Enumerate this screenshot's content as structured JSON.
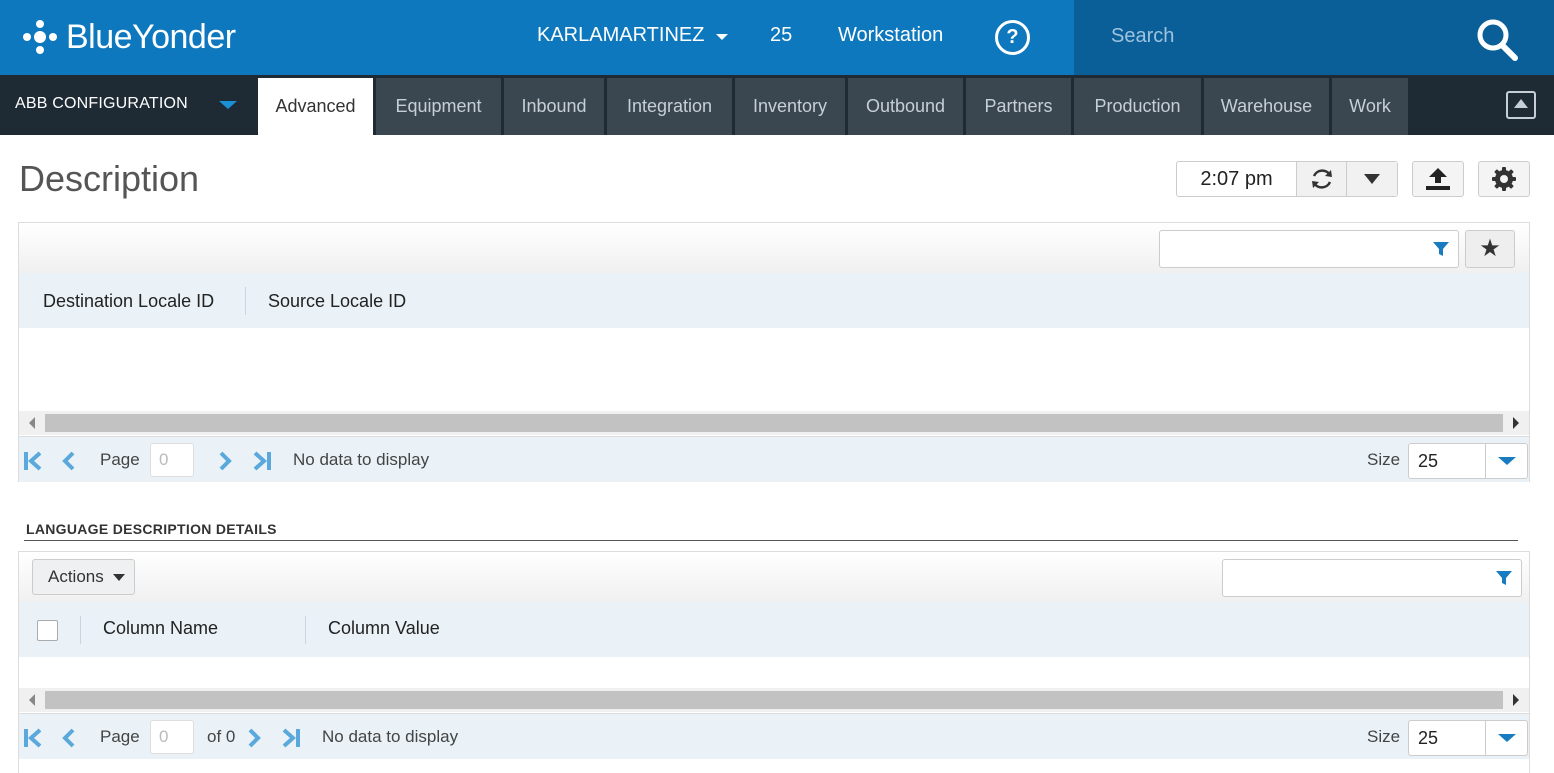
{
  "header": {
    "brand": "BlueYonder",
    "user": "KARLAMARTINEZ",
    "count": "25",
    "workstation": "Workstation",
    "help": "?",
    "search_placeholder": "Search"
  },
  "nav": {
    "workbench": "ABB CONFIGURATION",
    "tabs": [
      "Advanced",
      "Equipment",
      "Inbound",
      "Integration",
      "Inventory",
      "Outbound",
      "Partners",
      "Production",
      "Warehouse",
      "Work"
    ],
    "active_tab": "Advanced"
  },
  "page": {
    "title": "Description",
    "time": "2:07 pm"
  },
  "grid1": {
    "columns": [
      "Destination Locale ID",
      "Source Locale ID"
    ],
    "pager": {
      "page_label": "Page",
      "page_value": "0",
      "status": "No data to display",
      "size_label": "Size",
      "size_value": "25"
    }
  },
  "section": {
    "title": "LANGUAGE DESCRIPTION DETAILS"
  },
  "grid2": {
    "actions_label": "Actions",
    "columns": [
      "Column Name",
      "Column Value"
    ],
    "pager": {
      "page_label": "Page",
      "page_value": "0",
      "of_label": "of 0",
      "status": "No data to display",
      "size_label": "Size",
      "size_value": "25"
    }
  },
  "colors": {
    "primary": "#0e78be",
    "nav_bg": "#1f2b34",
    "tab_bg": "#3a4650",
    "accent": "#1a8fd6"
  }
}
